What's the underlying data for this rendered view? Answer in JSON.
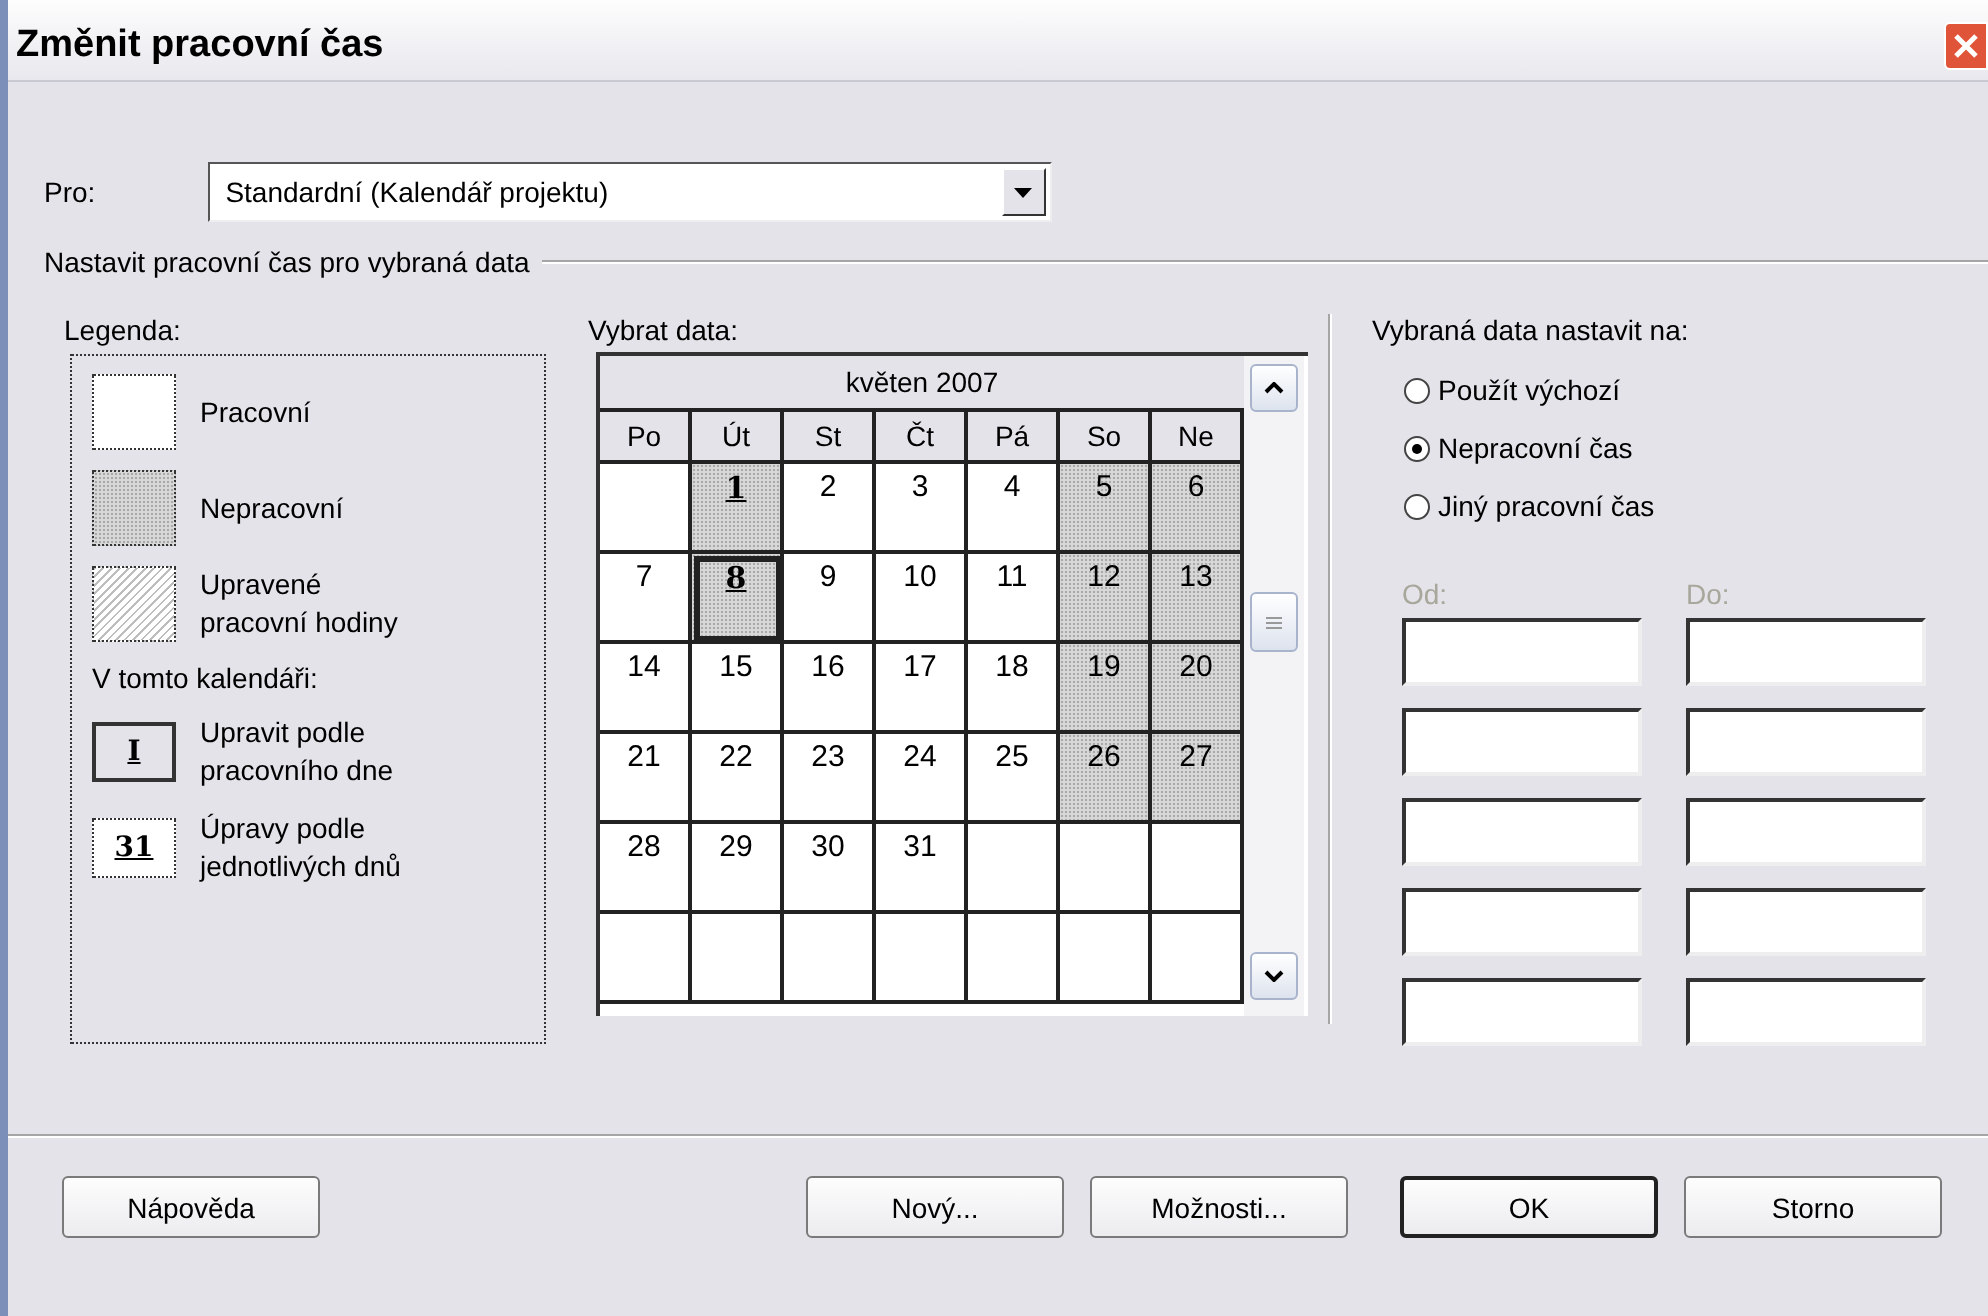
{
  "window": {
    "title": "Změnit pracovní čas"
  },
  "for": {
    "label": "Pro:",
    "value": "Standardní (Kalendář projektu)"
  },
  "group": {
    "title": "Nastavit pracovní čas pro vybraná data"
  },
  "legend": {
    "label": "Legenda:",
    "items": [
      {
        "kind": "working",
        "text": "Pracovní"
      },
      {
        "kind": "nonworking",
        "text": "Nepracovní"
      },
      {
        "kind": "edited",
        "text": "Upravené pracovní hodiny"
      }
    ],
    "subheading": "V tomto kalendáři:",
    "calendar_items": [
      {
        "kind": "weekday",
        "glyph": "I",
        "text": "Upravit podle pracovního dne"
      },
      {
        "kind": "day",
        "glyph": "31",
        "text": "Úpravy podle jednotlivých dnů"
      }
    ]
  },
  "calendar": {
    "label": "Vybrat data:",
    "month": "květen 2007",
    "weekdays": [
      "Po",
      "Út",
      "St",
      "Čt",
      "Pá",
      "So",
      "Ne"
    ],
    "weeks": [
      [
        {
          "nonworking": false,
          "selected": false
        },
        {
          "day": "1",
          "nonworking": true,
          "edited": true,
          "selected": false
        },
        {
          "day": "2",
          "nonworking": false,
          "edited": false,
          "selected": false
        },
        {
          "day": "3",
          "nonworking": false,
          "edited": false,
          "selected": false
        },
        {
          "day": "4",
          "nonworking": false,
          "edited": false,
          "selected": false
        },
        {
          "day": "5",
          "nonworking": true,
          "edited": false,
          "selected": false
        },
        {
          "day": "6",
          "nonworking": true,
          "edited": false,
          "selected": false
        }
      ],
      [
        {
          "day": "7",
          "nonworking": false,
          "edited": false,
          "selected": false
        },
        {
          "day": "8",
          "nonworking": true,
          "edited": true,
          "selected": true
        },
        {
          "day": "9",
          "nonworking": false,
          "edited": false,
          "selected": false
        },
        {
          "day": "10",
          "nonworking": false,
          "edited": false,
          "selected": false
        },
        {
          "day": "11",
          "nonworking": false,
          "edited": false,
          "selected": false
        },
        {
          "day": "12",
          "nonworking": true,
          "edited": false,
          "selected": false
        },
        {
          "day": "13",
          "nonworking": true,
          "edited": false,
          "selected": false
        }
      ],
      [
        {
          "day": "14",
          "nonworking": false,
          "edited": false,
          "selected": false
        },
        {
          "day": "15",
          "nonworking": false,
          "edited": false,
          "selected": false
        },
        {
          "day": "16",
          "nonworking": false,
          "edited": false,
          "selected": false
        },
        {
          "day": "17",
          "nonworking": false,
          "edited": false,
          "selected": false
        },
        {
          "day": "18",
          "nonworking": false,
          "edited": false,
          "selected": false
        },
        {
          "day": "19",
          "nonworking": true,
          "edited": false,
          "selected": false
        },
        {
          "day": "20",
          "nonworking": true,
          "edited": false,
          "selected": false
        }
      ],
      [
        {
          "day": "21",
          "nonworking": false,
          "edited": false,
          "selected": false
        },
        {
          "day": "22",
          "nonworking": false,
          "edited": false,
          "selected": false
        },
        {
          "day": "23",
          "nonworking": false,
          "edited": false,
          "selected": false
        },
        {
          "day": "24",
          "nonworking": false,
          "edited": false,
          "selected": false
        },
        {
          "day": "25",
          "nonworking": false,
          "edited": false,
          "selected": false
        },
        {
          "day": "26",
          "nonworking": true,
          "edited": false,
          "selected": false
        },
        {
          "day": "27",
          "nonworking": true,
          "edited": false,
          "selected": false
        }
      ],
      [
        {
          "day": "28",
          "nonworking": false,
          "edited": false,
          "selected": false
        },
        {
          "day": "29",
          "nonworking": false,
          "edited": false,
          "selected": false
        },
        {
          "day": "30",
          "nonworking": false,
          "edited": false,
          "selected": false
        },
        {
          "day": "31",
          "nonworking": false,
          "edited": false,
          "selected": false
        },
        {
          "nonworking": false,
          "selected": false
        },
        {
          "nonworking": false,
          "selected": false
        },
        {
          "nonworking": false,
          "selected": false
        }
      ],
      [
        {
          "nonworking": false,
          "selected": false
        },
        {
          "nonworking": false,
          "selected": false
        },
        {
          "nonworking": false,
          "selected": false
        },
        {
          "nonworking": false,
          "selected": false
        },
        {
          "nonworking": false,
          "selected": false
        },
        {
          "nonworking": false,
          "selected": false
        },
        {
          "nonworking": false,
          "selected": false
        }
      ]
    ]
  },
  "set_to": {
    "label": "Vybraná data nastavit na:",
    "options": [
      {
        "label": "Použít výchozí",
        "selected": false
      },
      {
        "label": "Nepracovní čas",
        "selected": true
      },
      {
        "label": "Jiný pracovní čas",
        "selected": false
      }
    ],
    "from_label": {
      "text": "Od:",
      "disabled": true
    },
    "to_label": {
      "text": "Do:",
      "disabled": true
    }
  },
  "buttons": [
    {
      "label": "Nápověda",
      "default": false
    },
    {
      "label": "Nový...",
      "default": false
    },
    {
      "label": "Možnosti...",
      "default": false
    },
    {
      "label": "OK",
      "default": true
    },
    {
      "label": "Storno",
      "default": false
    }
  ]
}
